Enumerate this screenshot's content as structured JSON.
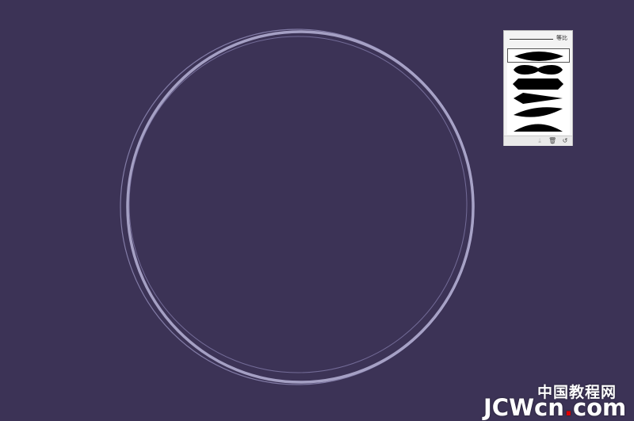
{
  "canvas": {
    "background_color": "#3c3356",
    "ring_colors": {
      "outer": "#a09cc4",
      "inner": "#8c86b2",
      "main": "#b4b0d4"
    }
  },
  "width_profile_panel": {
    "uniform_label": "等比",
    "profiles": [
      {
        "name": "width-profile-1",
        "selected": true
      },
      {
        "name": "width-profile-2",
        "selected": false
      },
      {
        "name": "width-profile-3",
        "selected": false
      },
      {
        "name": "width-profile-4",
        "selected": false
      },
      {
        "name": "width-profile-5",
        "selected": false
      },
      {
        "name": "width-profile-6",
        "selected": false
      }
    ],
    "footer_icons": [
      "add-profile-icon",
      "delete-profile-icon",
      "reset-profile-icon"
    ]
  },
  "watermark": {
    "cn_text": "中国教程网",
    "en_prefix": "JCWcn",
    "en_dot": ".",
    "en_suffix": "com",
    "dot_color": "#e00000"
  }
}
